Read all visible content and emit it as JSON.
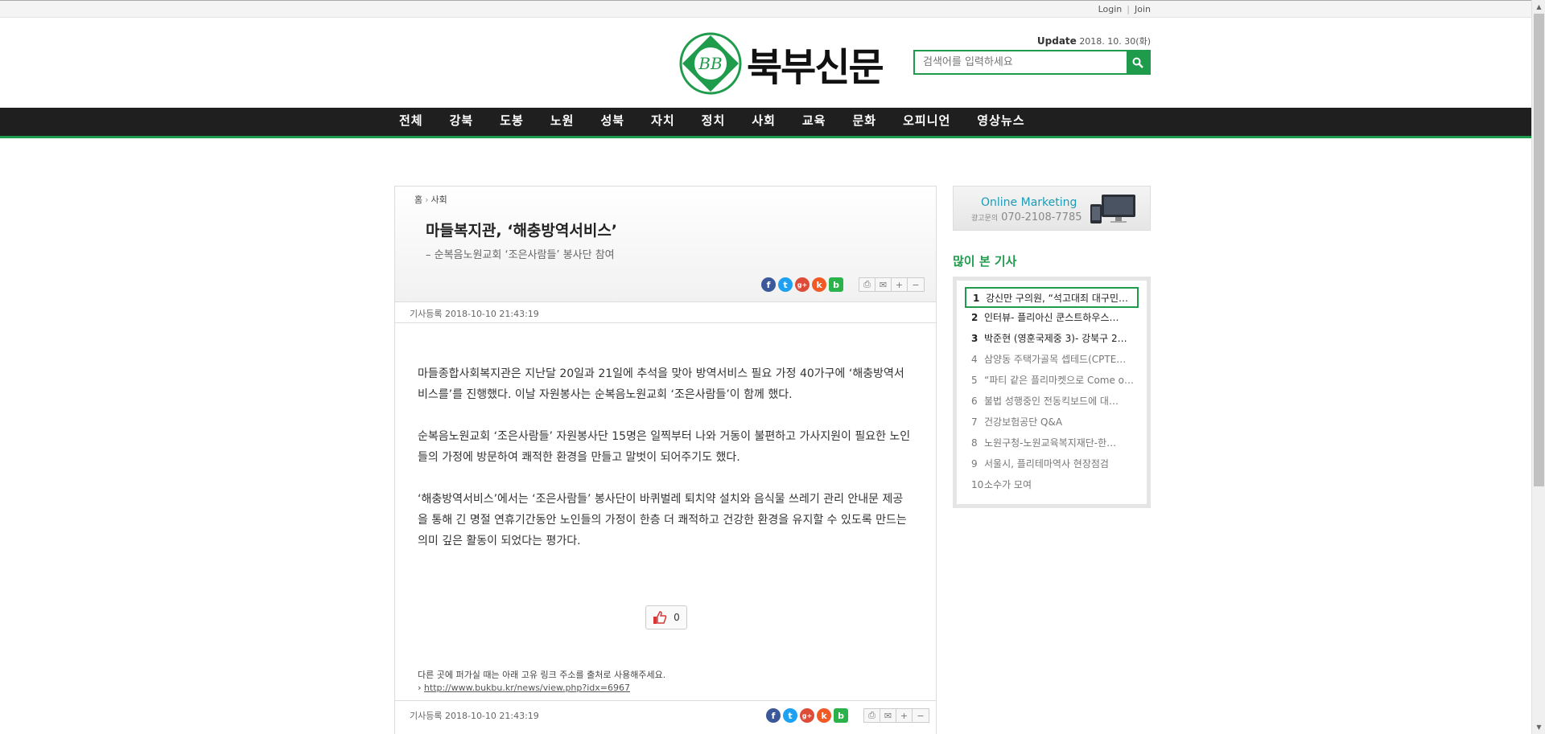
{
  "topbar": {
    "login": "Login",
    "join": "Join",
    "separator": "|"
  },
  "header": {
    "logo_text": "북부신문",
    "logo_letters": "BB",
    "update_label": "Update",
    "update_date": "2018. 10. 30(화)",
    "search_placeholder": "검색어를 입력하세요",
    "brand_color": "#1e9b4b"
  },
  "nav": {
    "items": [
      "전체",
      "강북",
      "도봉",
      "노원",
      "성북",
      "자치",
      "정치",
      "사회",
      "교육",
      "문화",
      "오피니언",
      "영상뉴스"
    ]
  },
  "article": {
    "breadcrumb": {
      "home": "홈",
      "arrow": "›",
      "section": "사회"
    },
    "title": "마들복지관, ‘해충방역서비스’",
    "subtitle": "– 순복음노원교회 ‘조은사람들’ 봉사단 참여",
    "date_top": "기사등록 2018-10-10 21:43:19",
    "paragraphs": [
      "마들종합사회복지관은 지난달 20일과 21일에 추석을 맞아 방역서비스 필요 가정 40가구에 ‘해충방역서비스를’를 진행했다. 이날 자원봉사는 순복음노원교회 ‘조은사람들’이 함께 했다.",
      "순복음노원교회 ‘조은사람들’ 자원봉사단 15명은 일찍부터 나와 거동이 불편하고 가사지원이 필요한 노인들의 가정에 방문하여 쾌적한 환경을 만들고 말벗이 되어주기도 했다.",
      "‘해충방역서비스’에서는 ‘조은사람들’ 봉사단이 바퀴벌레 퇴치약 설치와 음식물 쓰레기 관리 안내문 제공을 통해 긴 명절 연휴기간동안 노인들의 가정이 한층 더 쾌적하고 건강한 환경을 유지할 수 있도록 만드는 의미 깊은 활동이 되었다는 평가다."
    ],
    "like_count": "0",
    "permalink_note": "다른 곳에 퍼가실 때는 아래 고유 링크 주소를 출처로 사용해주세요.",
    "permalink_url": "http://www.bukbu.kr/news/view.php?idx=6967",
    "date_bottom": "기사등록 2018-10-10 21:43:19",
    "share_icons": {
      "facebook": "f",
      "twitter": "t",
      "google": "g+",
      "kakao": "k",
      "band": "b"
    },
    "tool_icons": {
      "print": "⎙",
      "mail": "✉",
      "zoom_in": "+",
      "zoom_out": "−"
    }
  },
  "sidebar": {
    "ad": {
      "headline": "Online Marketing",
      "label": "광고문의",
      "phone": "070-2108-7785"
    },
    "popular_title": "많이 본 기사",
    "popular": [
      {
        "n": "1",
        "t": "강신만 구의원, “석고대죄 대구민…"
      },
      {
        "n": "2",
        "t": "인터뷰- 플리아신 쿤스트하우스…"
      },
      {
        "n": "3",
        "t": "박준현 (영훈국제중 3)- 강북구 2…"
      },
      {
        "n": "4",
        "t": "삼양동 주택가골목 셉테드(CPTE…"
      },
      {
        "n": "5",
        "t": "“파티 같은 플리마켓으로 Come o…"
      },
      {
        "n": "6",
        "t": "불법 성행중인 전동킥보드에 대…"
      },
      {
        "n": "7",
        "t": "건강보험공단 Q&A"
      },
      {
        "n": "8",
        "t": "노원구청-노원교육복지재단-한…"
      },
      {
        "n": "9",
        "t": "서울시, 플리테마역사 현장점검"
      },
      {
        "n": "10",
        "t": "소수가 모여"
      }
    ]
  }
}
